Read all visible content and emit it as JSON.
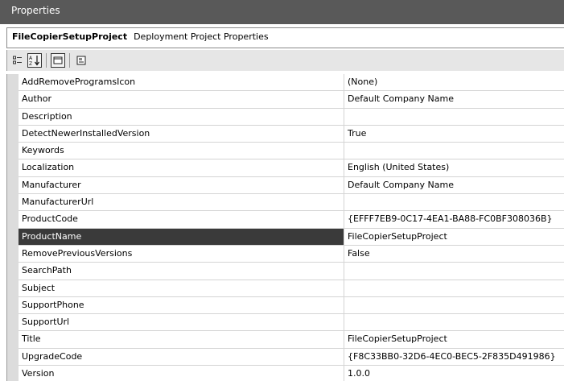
{
  "window": {
    "title": "Properties"
  },
  "header": {
    "object_name": "FileCopierSetupProject",
    "object_type": "Deployment Project Properties"
  },
  "toolbar": {
    "buttons": [
      {
        "icon": "categorized-icon",
        "active": false
      },
      {
        "icon": "alphabetical-icon",
        "active": true
      },
      {
        "icon": "properties-icon",
        "active": true
      },
      {
        "icon": "property-pages-icon",
        "active": false
      }
    ]
  },
  "properties": [
    {
      "name": "AddRemoveProgramsIcon",
      "value": "(None)"
    },
    {
      "name": "Author",
      "value": "Default Company Name"
    },
    {
      "name": "Description",
      "value": ""
    },
    {
      "name": "DetectNewerInstalledVersion",
      "value": "True"
    },
    {
      "name": "Keywords",
      "value": ""
    },
    {
      "name": "Localization",
      "value": "English (United States)"
    },
    {
      "name": "Manufacturer",
      "value": "Default Company Name"
    },
    {
      "name": "ManufacturerUrl",
      "value": ""
    },
    {
      "name": "ProductCode",
      "value": "{EFFF7EB9-0C17-4EA1-BA88-FC0BF308036B}"
    },
    {
      "name": "ProductName",
      "value": "FileCopierSetupProject",
      "selected": true
    },
    {
      "name": "RemovePreviousVersions",
      "value": "False"
    },
    {
      "name": "SearchPath",
      "value": ""
    },
    {
      "name": "Subject",
      "value": ""
    },
    {
      "name": "SupportPhone",
      "value": ""
    },
    {
      "name": "SupportUrl",
      "value": ""
    },
    {
      "name": "Title",
      "value": "FileCopierSetupProject"
    },
    {
      "name": "UpgradeCode",
      "value": "{F8C33BB0-32D6-4EC0-BEC5-2F835D491986}"
    },
    {
      "name": "Version",
      "value": "1.0.0"
    }
  ]
}
